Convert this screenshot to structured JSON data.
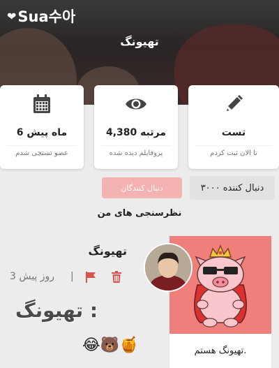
{
  "header": {
    "logo_text": "Sua수아",
    "logo_icon": "heart-icon",
    "title": "تهیونگ"
  },
  "stats": [
    {
      "icon": "pencil-icon",
      "value": "تست",
      "caption": "تا الان ثبت کردم"
    },
    {
      "icon": "eye-icon",
      "value": "4,380 مرتبه",
      "caption": "پروفایلم دیده شده"
    },
    {
      "icon": "calendar-icon",
      "value": "6 ماه پیش",
      "caption": "عضو تستچی شدم"
    }
  ],
  "followers_button": "دنبال کنندگان",
  "followers_count_text": "۳۰۰۰ دنبال کننده",
  "section_title": "نظرسنجی های من",
  "post": {
    "username": "تهیونگ",
    "time": "3 روز پیش",
    "separator": "|",
    "body_text": "تهیونگ :",
    "emojis": "😂🐻🍯",
    "caption": "تهیونگ هستم."
  },
  "colors": {
    "accent_pink": "#f4b2b2",
    "post_bg": "#f07e7b",
    "icon_red": "#d9534f"
  }
}
